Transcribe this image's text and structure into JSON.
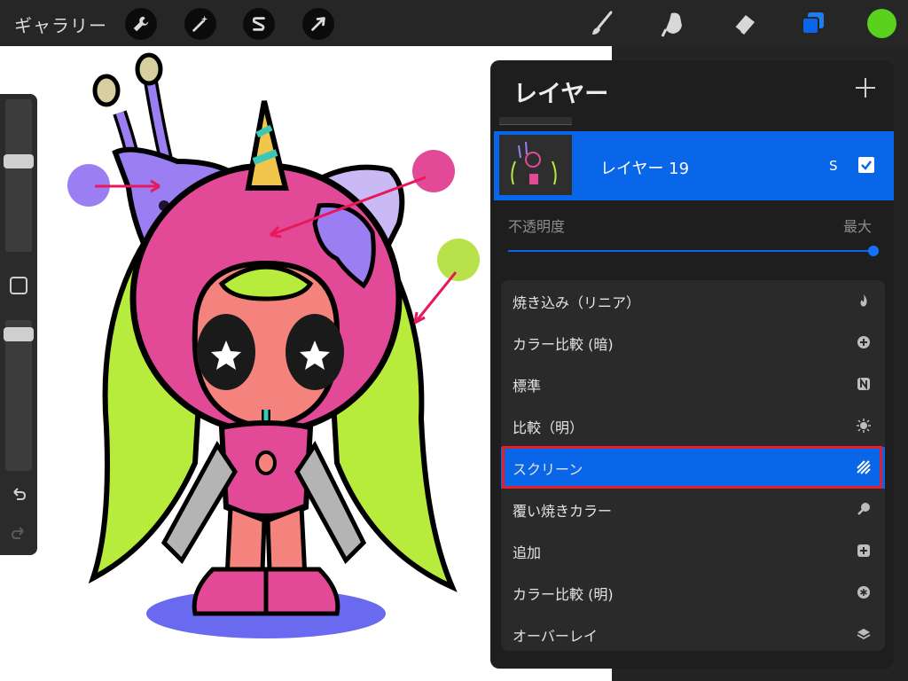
{
  "topbar": {
    "gallery_label": "ギャラリー",
    "tools_left": [
      {
        "icon": "wrench-icon"
      },
      {
        "icon": "magic-wand-icon"
      },
      {
        "icon": "selection-s-icon"
      },
      {
        "icon": "arrow-cursor-icon"
      }
    ],
    "tools_right": [
      {
        "icon": "brush-icon"
      },
      {
        "icon": "smudge-icon"
      },
      {
        "icon": "eraser-icon"
      },
      {
        "icon": "layers-icon"
      }
    ],
    "current_color": "#5ad11c"
  },
  "sidebar": {
    "size_slider_level": 0.6,
    "opacity_slider_level": 0.95,
    "modify_button": "square-icon",
    "undo": "undo-icon",
    "redo": "redo-icon"
  },
  "layers_panel": {
    "title": "レイヤー",
    "add_button": "plus-icon",
    "layer": {
      "name": "レイヤー 19",
      "blend_mode_letter": "S",
      "visible": true
    },
    "opacity": {
      "label": "不透明度",
      "value_label": "最大",
      "level": 1.0
    },
    "blend_modes": [
      {
        "label": "焼き込み（リニア）",
        "icon": "flame-icon"
      },
      {
        "label": "カラー比較 (暗)",
        "icon": "plus-circle-icon"
      },
      {
        "label": "標準",
        "icon": "n-badge-icon"
      },
      {
        "label": "比較（明）",
        "icon": "sunburst-icon"
      },
      {
        "label": "スクリーン",
        "icon": "stripes-icon",
        "selected": true
      },
      {
        "label": "覆い焼きカラー",
        "icon": "magnifier-icon"
      },
      {
        "label": "追加",
        "icon": "plus-square-icon"
      },
      {
        "label": "カラー比較 (明)",
        "icon": "asterisk-circle-icon"
      },
      {
        "label": "オーバーレイ",
        "icon": "layer-stack-icon"
      }
    ]
  },
  "colors": {
    "accent": "#0a66e8",
    "highlight_box": "#e0202c",
    "purple": "#9a7ef2",
    "pink": "#e24a97",
    "lime": "#b9e24a"
  }
}
